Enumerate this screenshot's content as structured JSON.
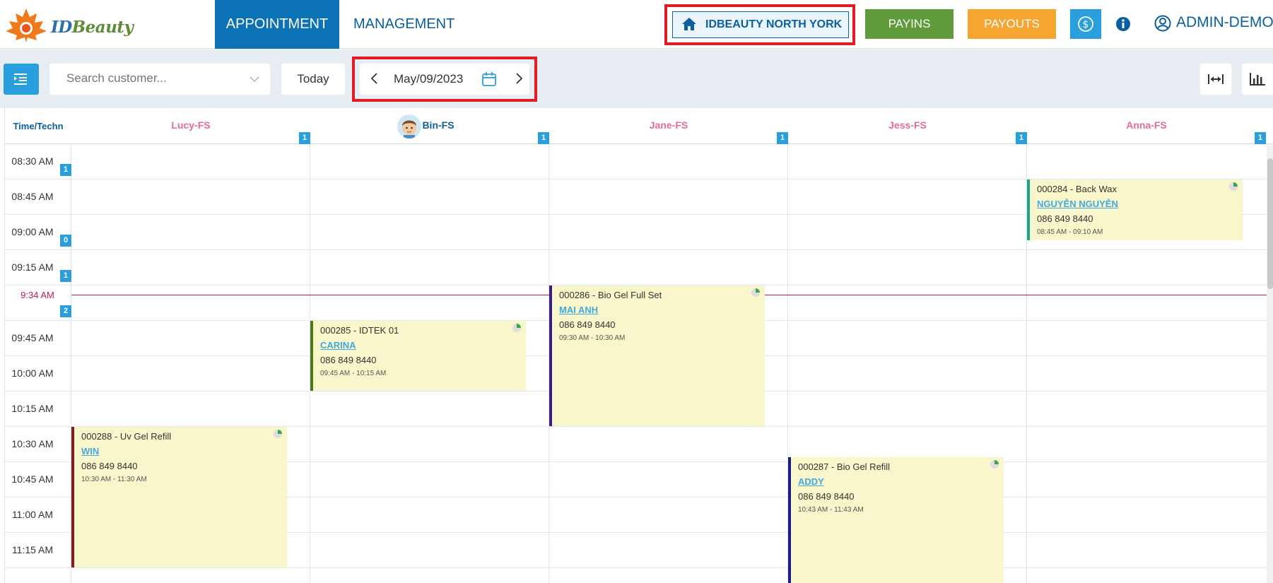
{
  "brand": {
    "logo_text_a": "ID",
    "logo_text_b": "Beauty"
  },
  "nav": {
    "appointment": "APPOINTMENT",
    "management": "MANAGEMENT"
  },
  "store": {
    "name": "IDBEAUTY NORTH YORK"
  },
  "actions": {
    "payins": "PAYINS",
    "payouts": "PAYOUTS",
    "user": "ADMIN-DEMO"
  },
  "toolbar": {
    "search_placeholder": "Search customer...",
    "today": "Today",
    "date": "May/09/2023"
  },
  "calendar": {
    "time_header": "Time/Techn",
    "technicians": [
      {
        "name": "Lucy-FS",
        "count": "1",
        "active": false
      },
      {
        "name": "Bin-FS",
        "count": "1",
        "active": true
      },
      {
        "name": "Jane-FS",
        "count": "1",
        "active": false
      },
      {
        "name": "Jess-FS",
        "count": "1",
        "active": false
      },
      {
        "name": "Anna-FS",
        "count": "1",
        "active": false
      }
    ],
    "slots": [
      {
        "time": "08:30 AM",
        "badge": "1"
      },
      {
        "time": "08:45 AM",
        "badge": ""
      },
      {
        "time": "09:00 AM",
        "badge": "0"
      },
      {
        "time": "09:15 AM",
        "badge": "1"
      },
      {
        "time": "",
        "badge": "2"
      },
      {
        "time": "09:45 AM",
        "badge": ""
      },
      {
        "time": "10:00 AM",
        "badge": ""
      },
      {
        "time": "10:15 AM",
        "badge": ""
      },
      {
        "time": "10:30 AM",
        "badge": ""
      },
      {
        "time": "10:45 AM",
        "badge": ""
      },
      {
        "time": "11:00 AM",
        "badge": ""
      },
      {
        "time": "11:15 AM",
        "badge": ""
      }
    ],
    "now_label": "9:34 AM",
    "appointments": [
      {
        "title": "000284 - Back Wax",
        "customer": "NGUYỄN NGUYỄN",
        "phone": "086 849 8440",
        "time": "08:45 AM - 09:10 AM",
        "accent": "#1aa58b"
      },
      {
        "title": "000286 - Bio Gel Full Set",
        "customer": "MAI ANH",
        "phone": "086 849 8440",
        "time": "09:30 AM - 10:30 AM",
        "accent": "#3a1d8c"
      },
      {
        "title": "000285 - IDTEK 01",
        "customer": "CARINA",
        "phone": "086 849 8440",
        "time": "09:45 AM - 10:15 AM",
        "accent": "#4d7a16"
      },
      {
        "title": "000288 - Uv Gel Refill",
        "customer": "WIN",
        "phone": "086 849 8440",
        "time": "10:30 AM - 11:30 AM",
        "accent": "#8b1a1a"
      },
      {
        "title": "000287 - Bio Gel Refill",
        "customer": "ADDY",
        "phone": "086 849 8440",
        "time": "10:43 AM - 11:43 AM",
        "accent": "#1a1a8c"
      }
    ]
  }
}
